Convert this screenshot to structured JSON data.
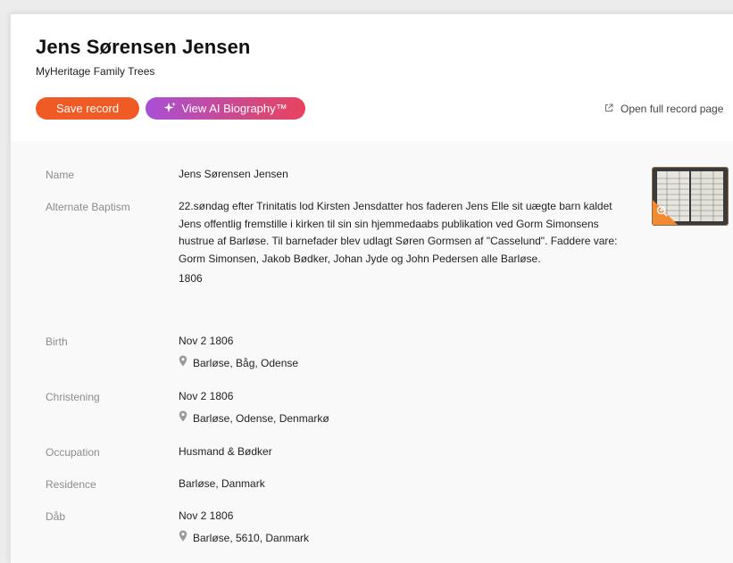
{
  "record": {
    "title": "Jens Sørensen Jensen",
    "source": "MyHeritage Family Trees"
  },
  "actions": {
    "save_label": "Save record",
    "ai_label": "View AI Biography™",
    "open_full_label": "Open full record page"
  },
  "colors": {
    "save_button": "#f05a24",
    "ai_button_from": "#a84fd6",
    "ai_button_to": "#e9425e",
    "zoom_badge": "#f28a33"
  },
  "icons": {
    "ai": "sparkle-icon",
    "open_full": "external-link-icon",
    "place": "map-pin-icon",
    "zoom": "zoom-in-icon"
  },
  "fields": {
    "name": {
      "label": "Name",
      "value": "Jens Sørensen Jensen"
    },
    "alternate_baptism": {
      "label": "Alternate Baptism",
      "text": "22.søndag efter Trinitatis lod Kirsten Jensdatter hos faderen Jens Elle sit uægte barn kaldet Jens offentlig fremstille i kirken til sin sin hjemmedaabs publikation ved Gorm Simonsens hustrue af Barløse. Til barnefader blev udlagt Søren Gormsen af \"Casselund\". Faddere vare: Gorm Simonsen, Jakob Bødker, Johan Jyde og John Pedersen alle Barløse.",
      "year": "1806"
    },
    "birth": {
      "label": "Birth",
      "date": "Nov 2 1806",
      "place": "Barløse, Båg, Odense"
    },
    "christening": {
      "label": "Christening",
      "date": "Nov 2 1806",
      "place": "Barløse, Odense, Denmarkø"
    },
    "occupation": {
      "label": "Occupation",
      "value": "Husmand & Bødker"
    },
    "residence": {
      "label": "Residence",
      "value": "Barløse, Danmark"
    },
    "dab": {
      "label": "Dåb",
      "date": "Nov 2 1806",
      "place": "Barløse, 5610, Danmark"
    }
  }
}
